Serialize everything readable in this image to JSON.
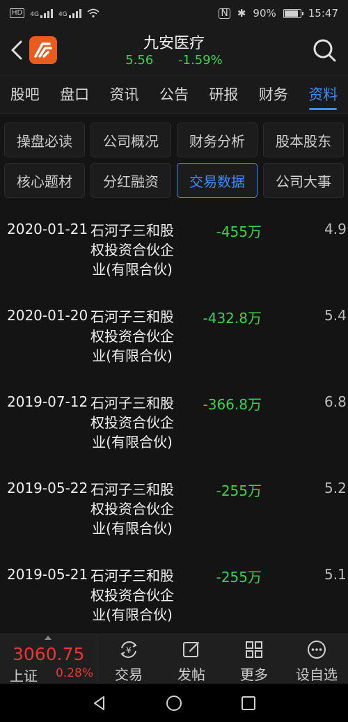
{
  "status": {
    "hd_label": "HD",
    "net1": "4G",
    "net2": "4G",
    "battery": "90%",
    "battery_level": 0.9,
    "time": "15:47"
  },
  "header": {
    "title": "九安医疗",
    "price": "5.56",
    "change": "-1.59%"
  },
  "tabs": [
    {
      "label": "股吧"
    },
    {
      "label": "盘口"
    },
    {
      "label": "资讯"
    },
    {
      "label": "公告"
    },
    {
      "label": "研报"
    },
    {
      "label": "财务"
    },
    {
      "label": "资料"
    }
  ],
  "active_tab": 6,
  "subtabs": [
    {
      "label": "操盘必读"
    },
    {
      "label": "公司概况"
    },
    {
      "label": "财务分析"
    },
    {
      "label": "股本股东"
    },
    {
      "label": "核心题材"
    },
    {
      "label": "分红融资"
    },
    {
      "label": "交易数据"
    },
    {
      "label": "公司大事"
    }
  ],
  "active_subtab": 6,
  "records": [
    {
      "date": "2020-01-21",
      "holder": "石河子三和股权投资合伙企业(有限合伙)",
      "amount": "-455万",
      "extra": "4.9"
    },
    {
      "date": "2020-01-20",
      "holder": "石河子三和股权投资合伙企业(有限合伙)",
      "amount": "-432.8万",
      "extra": "5.4"
    },
    {
      "date": "2019-07-12",
      "holder": "石河子三和股权投资合伙企业(有限合伙)",
      "amount": "-366.8万",
      "extra": "6.8"
    },
    {
      "date": "2019-05-22",
      "holder": "石河子三和股权投资合伙企业(有限合伙)",
      "amount": "-255万",
      "extra": "5.2"
    },
    {
      "date": "2019-05-21",
      "holder": "石河子三和股权投资合伙企业(有限合伙)",
      "amount": "-255万",
      "extra": "5.1"
    }
  ],
  "bottom": {
    "index_value": "3060.75",
    "index_name": "上证",
    "index_pct": "0.28%",
    "tools": [
      {
        "label": "交易",
        "icon": "yuan-exchange-icon"
      },
      {
        "label": "发帖",
        "icon": "edit-icon"
      },
      {
        "label": "更多",
        "icon": "grid-icon"
      },
      {
        "label": "设自选",
        "icon": "more-dots-icon"
      }
    ]
  },
  "colors": {
    "accent": "#3d8ef5",
    "down": "#3fd24a",
    "up": "#e53935",
    "logo": "#e85c1f"
  }
}
